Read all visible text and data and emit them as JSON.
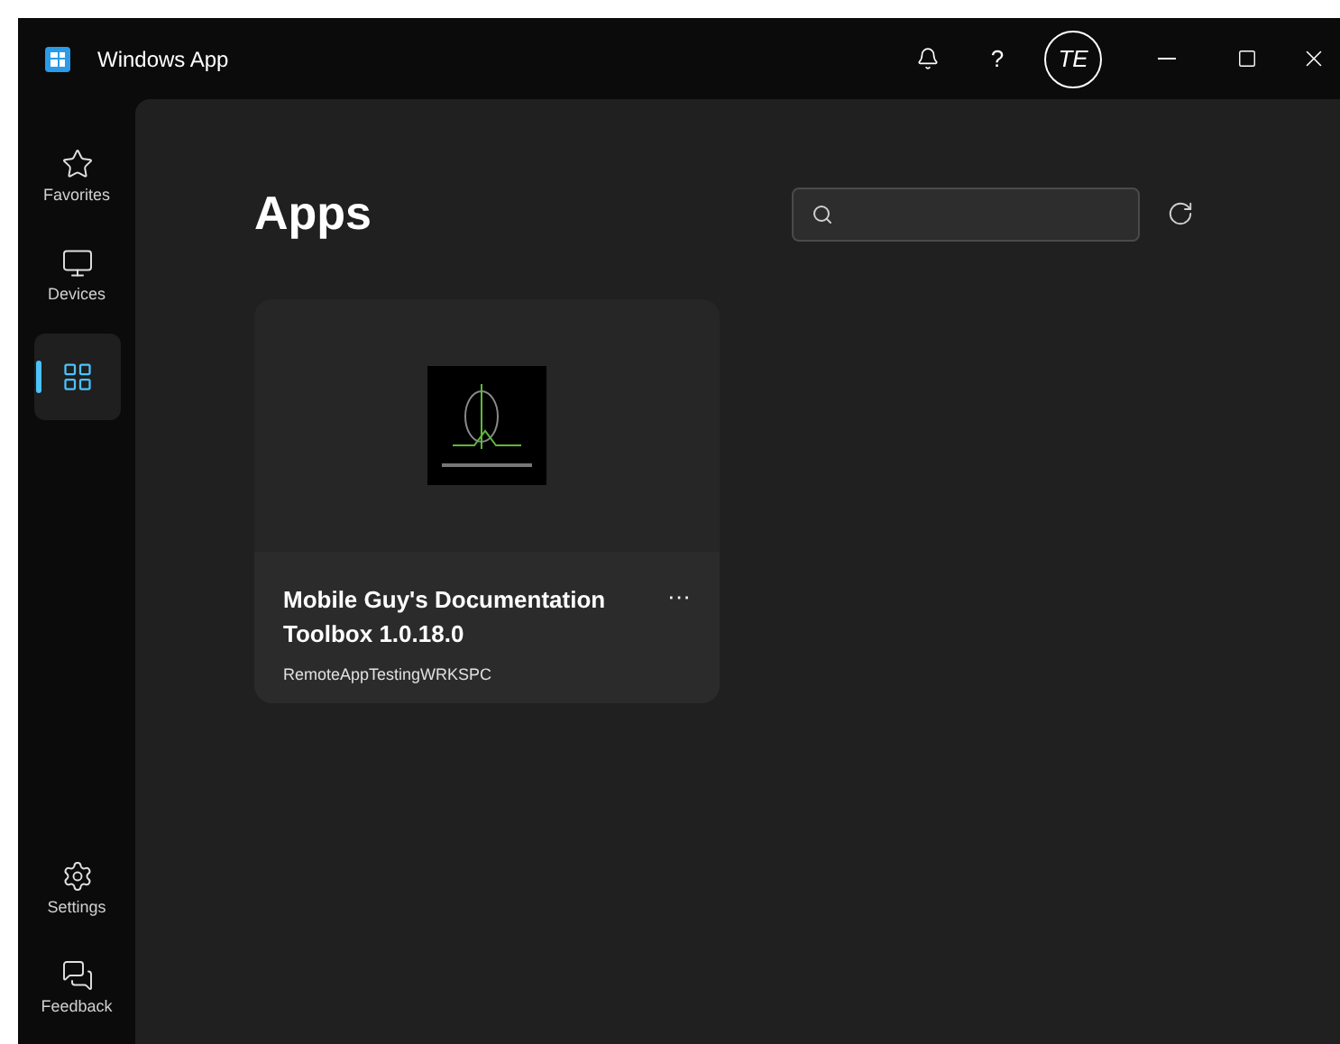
{
  "window": {
    "title": "Windows App",
    "avatar": "TE",
    "help": "?"
  },
  "sidebar": {
    "items": [
      {
        "kind": "star",
        "label": "Favorites",
        "selected": false
      },
      {
        "kind": "monitor",
        "label": "Devices",
        "selected": false
      },
      {
        "kind": "apps",
        "selected": true
      }
    ],
    "bottom": [
      {
        "kind": "settings",
        "label": "Settings"
      },
      {
        "kind": "feedback",
        "label": "Feedback"
      }
    ]
  },
  "page": {
    "title": "Apps"
  },
  "apps": [
    {
      "name": "Mobile Guy's Documentation Toolbox 1.0.18.0",
      "workspace": "RemoteAppTestingWRKSPC",
      "more": "···"
    }
  ]
}
